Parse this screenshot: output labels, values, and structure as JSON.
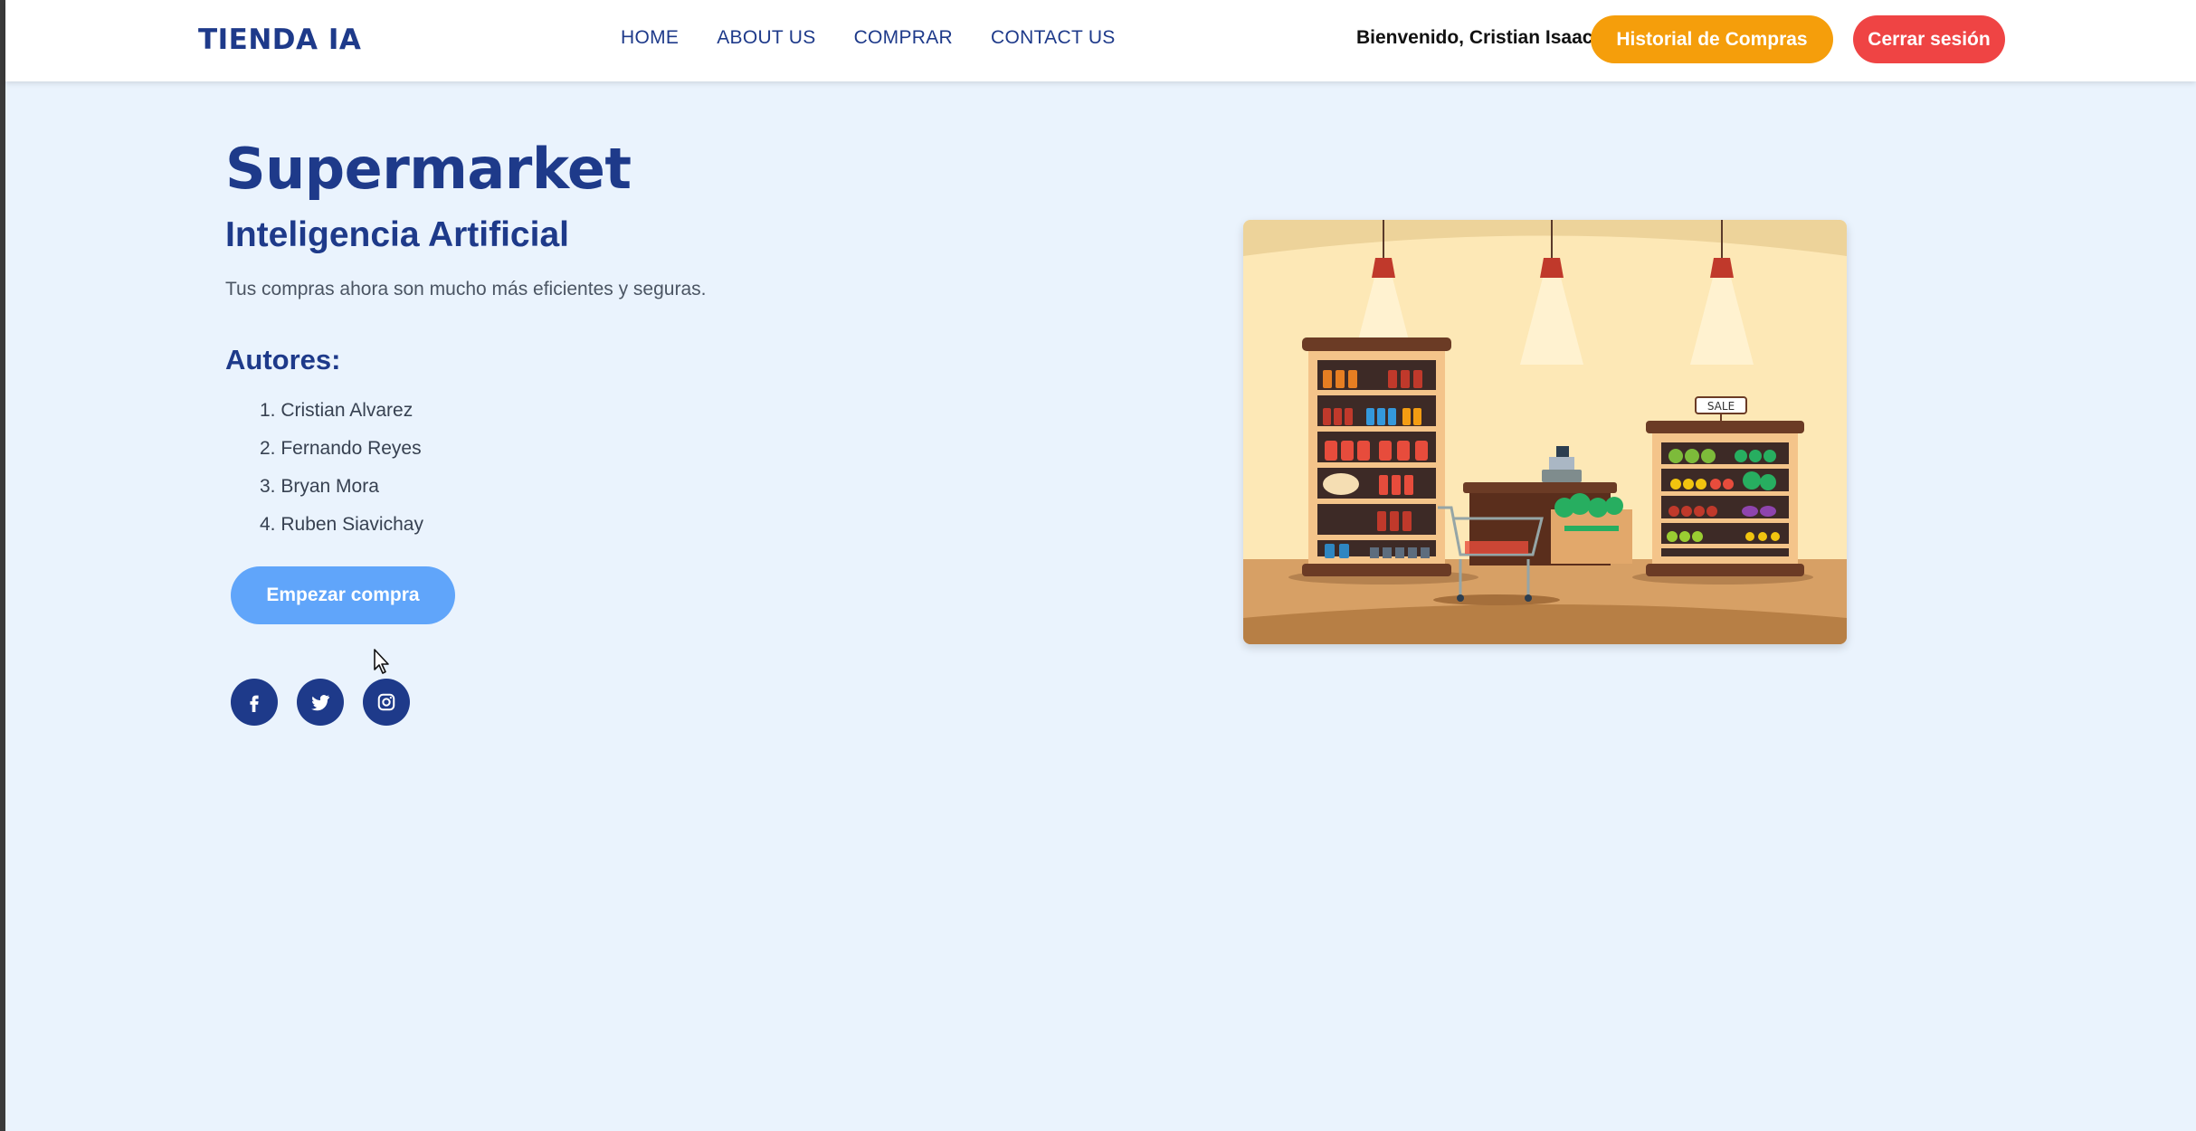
{
  "header": {
    "brand": "TIENDA IA",
    "nav": [
      {
        "label": "HOME"
      },
      {
        "label": "ABOUT US"
      },
      {
        "label": "COMPRAR"
      },
      {
        "label": "CONTACT US"
      }
    ],
    "welcome": "Bienvenido, Cristian Isaac",
    "history_button": "Historial de Compras",
    "logout_button": "Cerrar sesión"
  },
  "hero": {
    "title": "Supermarket",
    "subtitle": "Inteligencia Artificial",
    "tagline": "Tus compras ahora son mucho más eficientes y seguras.",
    "authors_heading": "Autores:",
    "authors": [
      "1. Cristian Alvarez",
      "2. Fernando Reyes",
      "3. Bryan Mora",
      "4. Ruben Siavichay"
    ],
    "start_button": "Empezar compra",
    "socials": [
      {
        "icon": "facebook-icon"
      },
      {
        "icon": "twitter-icon"
      },
      {
        "icon": "instagram-icon"
      }
    ],
    "illustration": {
      "sale_sign": "SALE"
    }
  },
  "colors": {
    "primary": "#1e3a8a",
    "background": "#eaf3fd",
    "history": "#f59e0b",
    "logout": "#ef4444",
    "start": "#60a5fa"
  }
}
